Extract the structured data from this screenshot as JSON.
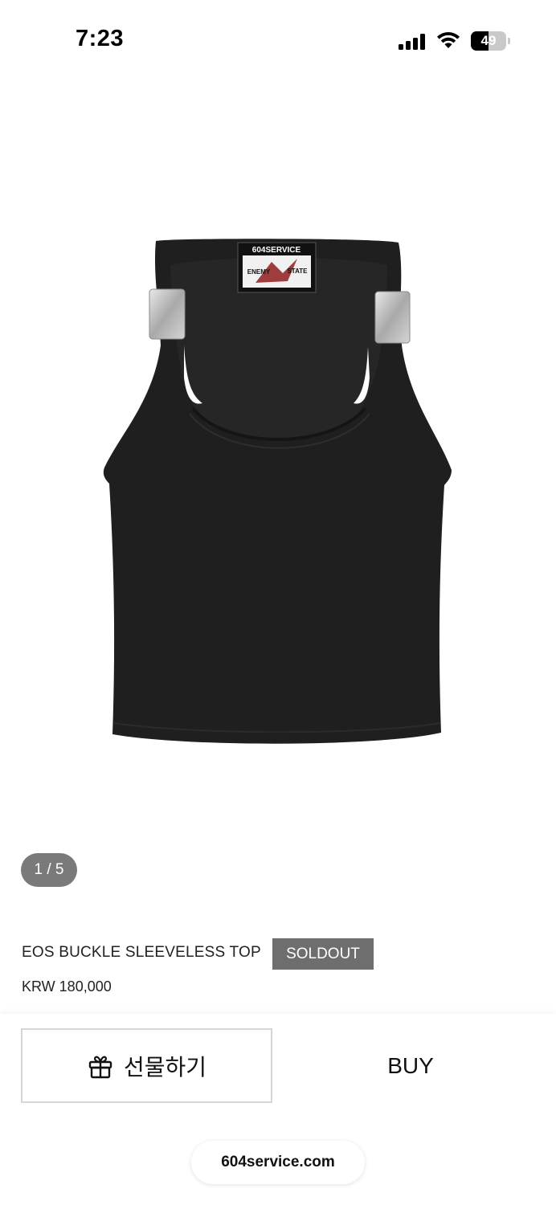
{
  "status_bar": {
    "time": "7:23",
    "battery_percent": "49",
    "battery_level": 0.49,
    "icons": [
      "signal-icon",
      "wifi-icon",
      "battery-icon"
    ]
  },
  "product": {
    "image": {
      "description_icon": "black-tank-top-photo",
      "label_brand": "604SERVICE",
      "label_left": "ENEMY",
      "label_right": "STATE",
      "current_index": 1,
      "total": 5,
      "counter_text": "1 / 5"
    },
    "name": "EOS BUCKLE SLEEVELESS TOP",
    "status_badge": "SOLDOUT",
    "price": "KRW 180,000"
  },
  "actions": {
    "gift_label": "선물하기",
    "gift_icon": "gift-icon",
    "buy_label": "BUY"
  },
  "browser": {
    "domain": "604service.com"
  }
}
